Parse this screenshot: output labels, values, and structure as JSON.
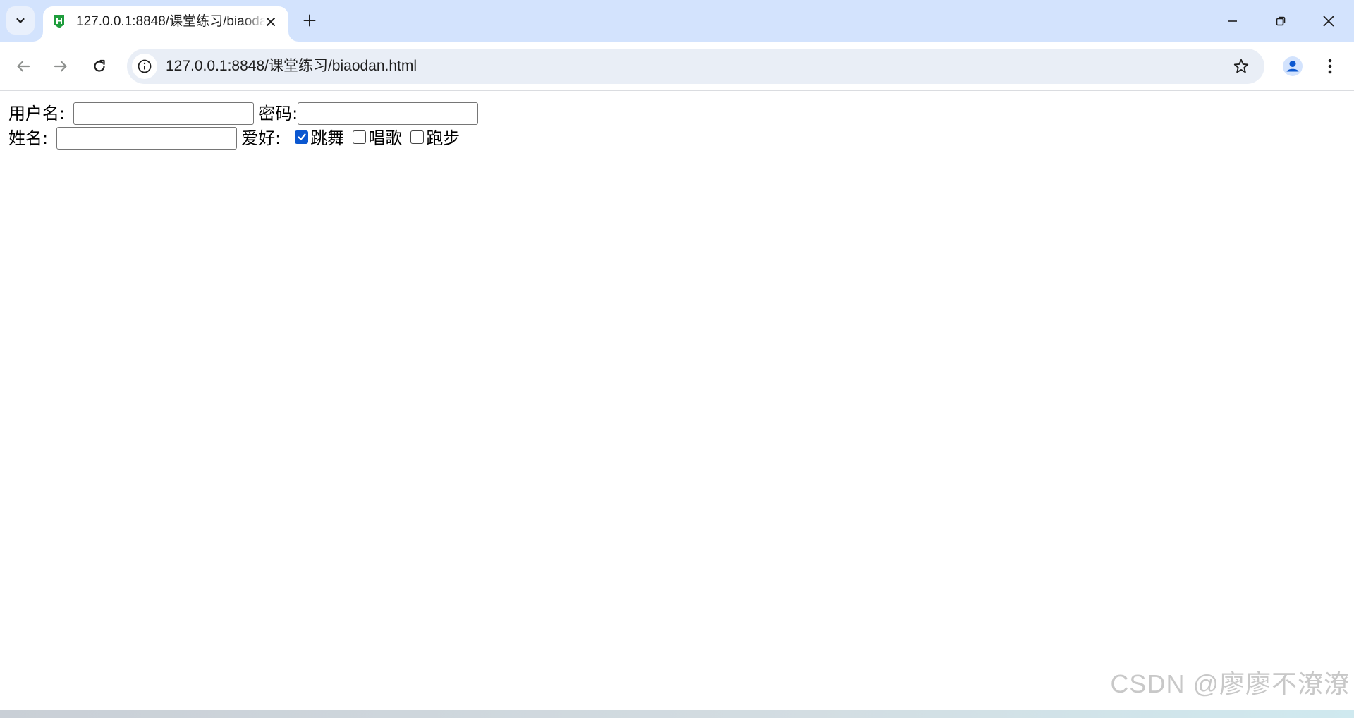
{
  "browser": {
    "tab": {
      "title": "127.0.0.1:8848/课堂练习/biaodan.html",
      "favicon": "hbuilder-icon"
    },
    "url": "127.0.0.1:8848/课堂练习/biaodan.html",
    "icons": {
      "tab_search": "chevron-down-icon",
      "close_tab": "close-icon",
      "new_tab": "plus-icon",
      "minimize": "minimize-icon",
      "restore": "restore-icon",
      "close_window": "close-icon",
      "back": "arrow-left-icon",
      "forward": "arrow-right-icon",
      "reload": "reload-icon",
      "site_info": "info-icon",
      "bookmark": "star-icon",
      "profile": "person-icon",
      "menu": "kebab-menu-icon"
    },
    "colors": {
      "tabbar": "#d3e3fd",
      "omnibox": "#e9eef6",
      "accent": "#0b57d0",
      "favicon": "#1f9d3d"
    }
  },
  "form": {
    "username_label": "用户名:",
    "username_value": "",
    "password_label": "密码:",
    "password_value": "",
    "name_label": "姓名:",
    "name_value": "",
    "hobby_label": "爱好:",
    "hobbies": [
      {
        "label": "跳舞",
        "checked": true
      },
      {
        "label": "唱歌",
        "checked": false
      },
      {
        "label": "跑步",
        "checked": false
      }
    ]
  },
  "watermark": "CSDN @廖廖不潦潦"
}
